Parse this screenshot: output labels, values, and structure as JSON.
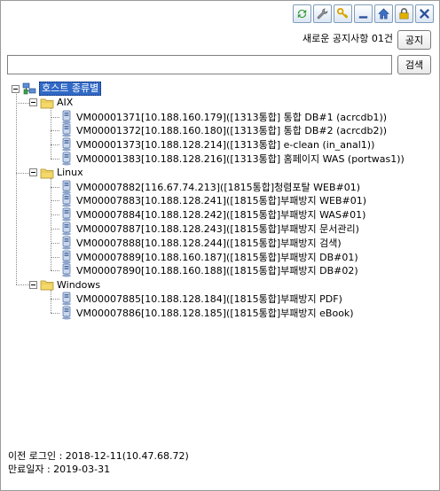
{
  "toolbar": {
    "buttons": [
      {
        "icon": "refresh-icon"
      },
      {
        "icon": "wrench-icon"
      },
      {
        "icon": "key-icon"
      },
      {
        "icon": "minimize-icon"
      },
      {
        "icon": "home-icon"
      },
      {
        "icon": "lock-icon"
      },
      {
        "icon": "close-icon"
      }
    ]
  },
  "notice": {
    "text": "새로운 공지사항 01건",
    "button_label": "공지"
  },
  "search": {
    "value": "",
    "placeholder": "",
    "button_label": "검색"
  },
  "tree": {
    "root_label": "호스트 종류별",
    "groups": [
      {
        "label": "AIX",
        "hosts": [
          "VM00001371[10.188.160.179]([1313통합] 통합 DB#1 (acrcdb1))",
          "VM00001372[10.188.160.180]([1313통합] 통합 DB#2 (acrcdb2))",
          "VM00001373[10.188.128.214]([1313통합] e-clean (in_anal1))",
          "VM00001383[10.188.128.216]([1313통합] 홈페이지 WAS (portwas1))"
        ]
      },
      {
        "label": "Linux",
        "hosts": [
          "VM00007882[116.67.74.213]([1815통합]청렴포탈 WEB#01)",
          "VM00007883[10.188.128.241]([1815통합]부패방지 WEB#01)",
          "VM00007884[10.188.128.242]([1815통합]부패방지 WAS#01)",
          "VM00007887[10.188.128.243]([1815통합]부패방지 문서관리)",
          "VM00007888[10.188.128.244]([1815통합]부패방지 검색)",
          "VM00007889[10.188.160.187]([1815통합]부패방지 DB#01)",
          "VM00007890[10.188.160.188]([1815통합]부패방지 DB#02)"
        ]
      },
      {
        "label": "Windows",
        "hosts": [
          "VM00007885[10.188.128.184]([1815통합]부패방지 PDF)",
          "VM00007886[10.188.128.185]([1815통합]부패방지 eBook)"
        ]
      }
    ]
  },
  "footer": {
    "last_login": "이전 로그인 : 2018-12-11(10.47.68.72)",
    "expiry": "만료일자 : 2019-03-31"
  },
  "colors": {
    "selection": "#3169c6",
    "toolbar_border": "#7f9db9",
    "folder": "#f5d86a"
  }
}
